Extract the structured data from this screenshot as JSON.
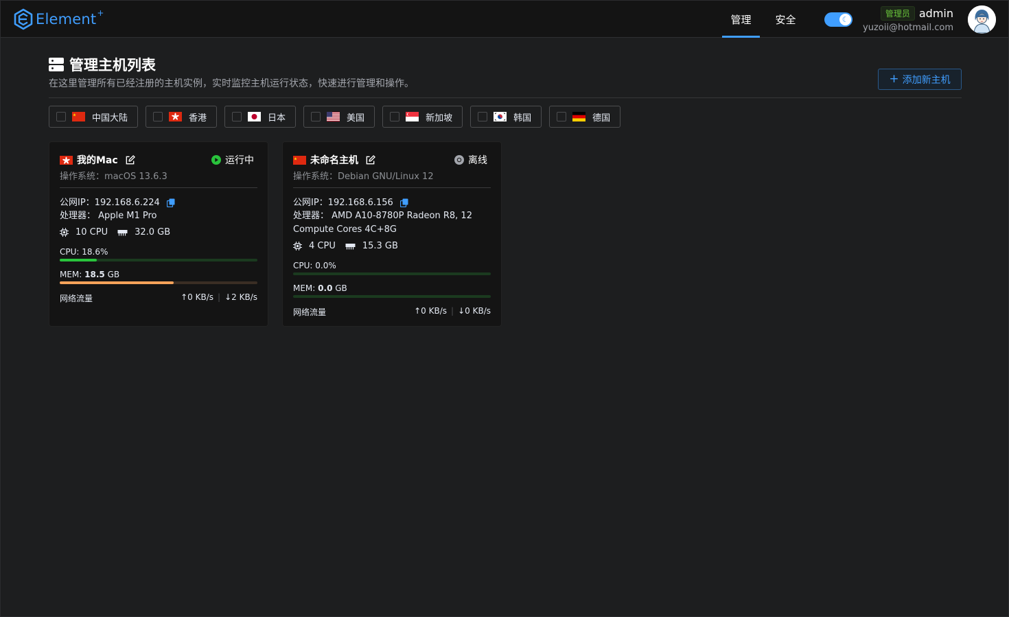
{
  "header": {
    "logo_text": "Element",
    "logo_sup": "+",
    "nav": [
      {
        "label": "管理"
      },
      {
        "label": "安全"
      }
    ],
    "theme_toggle": {
      "on": true,
      "icon": "moon-icon"
    },
    "user": {
      "role": "管理员",
      "name": "admin",
      "email": "yuzoii@hotmail.com"
    },
    "accent_color": "#409eff"
  },
  "page": {
    "title": "管理主机列表",
    "description": "在这里管理所有已经注册的主机实例，实时监控主机运行状态，快速进行管理和操作。",
    "add_button": "添加新主机"
  },
  "filters": [
    {
      "label": "中国大陆",
      "flag": "cn",
      "checked": false
    },
    {
      "label": "香港",
      "flag": "hk",
      "checked": false
    },
    {
      "label": "日本",
      "flag": "jp",
      "checked": false
    },
    {
      "label": "美国",
      "flag": "us",
      "checked": false
    },
    {
      "label": "新加坡",
      "flag": "sg",
      "checked": false
    },
    {
      "label": "韩国",
      "flag": "kr",
      "checked": false
    },
    {
      "label": "德国",
      "flag": "de",
      "checked": false
    }
  ],
  "hosts": [
    {
      "flag": "hk",
      "name": "我的Mac",
      "status": "运行中",
      "status_color": "#29c33c",
      "os": "操作系统：macOS 13.6.3",
      "ip_label": "公网IP：192.168.6.224",
      "cpu_model_label": "处理器：  Apple M1 Pro",
      "cpu_count": "10 CPU",
      "memory_total": "32.0 GB",
      "cpu_usage_label": "CPU: 18.6%",
      "cpu_usage": 0.186,
      "cpu_bar_color": "#29c33c",
      "mem_label_prefix": "MEM: ",
      "mem_used": "18.5",
      "mem_label_suffix": " GB",
      "mem_usage": 0.578,
      "mem_bar_color": "#f5a25a",
      "net_label": "网络流量",
      "net_up": "0 KB/s",
      "net_down": "2 KB/s"
    },
    {
      "flag": "cn",
      "name": "未命名主机",
      "status": "离线",
      "status_color": "#a3a6ad",
      "os": "操作系统：Debian GNU/Linux 12",
      "ip_label": "公网IP：192.168.6.156",
      "cpu_model_label": "处理器：  AMD A10-8780P Radeon R8, 12 Compute Cores 4C+8G",
      "cpu_count": "4 CPU",
      "memory_total": "15.3 GB",
      "cpu_usage_label": "CPU: 0.0%",
      "cpu_usage": 0.0,
      "cpu_bar_color": "#29c33c",
      "mem_label_prefix": "MEM: ",
      "mem_used": "0.0",
      "mem_label_suffix": " GB",
      "mem_usage": 0.0,
      "mem_bar_color": "#29c33c",
      "net_label": "网络流量",
      "net_up": "0 KB/s",
      "net_down": "0 KB/s"
    }
  ]
}
